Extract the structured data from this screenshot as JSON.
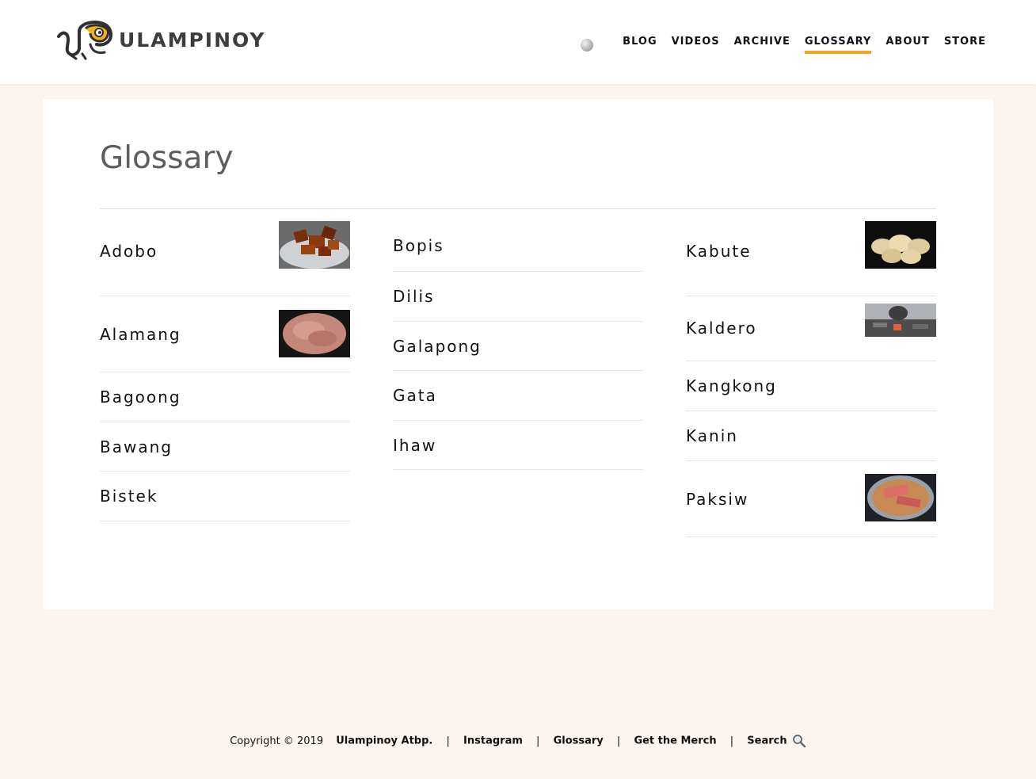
{
  "brand": {
    "name": "ULAMPINOY"
  },
  "nav": {
    "items": [
      "BLOG",
      "VIDEOS",
      "ARCHIVE",
      "GLOSSARY",
      "ABOUT",
      "STORE"
    ],
    "active": "GLOSSARY"
  },
  "colors": {
    "accent": "#f2a623",
    "background": "#fcf5ef",
    "card": "#ffffff"
  },
  "page": {
    "title": "Glossary"
  },
  "glossary": {
    "col1": [
      "Adobo",
      "Alamang",
      "Bagoong",
      "Bawang",
      "Bistek"
    ],
    "col2": [
      "Bopis",
      "Dilis",
      "Galapong",
      "Gata",
      "Ihaw"
    ],
    "col3": [
      "Kabute",
      "Kaldero",
      "Kangkong",
      "Kanin",
      "Paksiw"
    ]
  },
  "footer": {
    "copyright": "Copyright © 2019",
    "links": [
      "Ulampinoy Atbp.",
      "Instagram",
      "Glossary",
      "Get the Merch",
      "Search"
    ],
    "separator": "|"
  },
  "icons": {
    "search": "search-icon",
    "logo": "chameleon-logo-icon"
  }
}
